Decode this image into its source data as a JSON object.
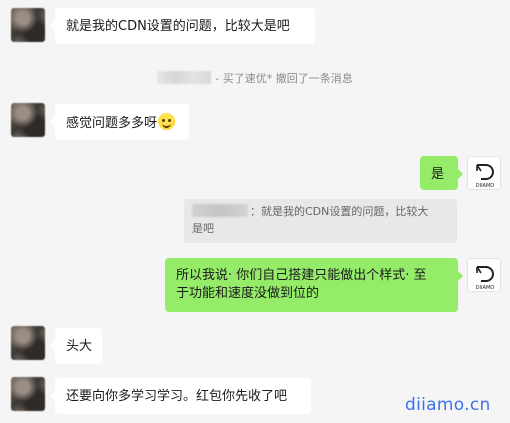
{
  "messages": [
    {
      "side": "left",
      "text": "就是我的CDN设置的问题，比较大是吧"
    },
    {
      "side": "left",
      "text": "感觉问题多多呀"
    },
    {
      "side": "right",
      "text": "是"
    },
    {
      "side": "right",
      "lines": [
        "所以我说· 你们自己搭建只能做出个样式· 至",
        "于功能和速度没做到位的"
      ]
    },
    {
      "side": "left",
      "text": "头大"
    },
    {
      "side": "left",
      "text": "还要向你多学习学习。红包你先收了吧"
    }
  ],
  "system_notice": "- 买了速优* 撤回了一条消息",
  "quote": {
    "line1": "：就是我的CDN设置的问题，比较大",
    "line2": "是吧"
  },
  "self_avatar_text": "DIIAMO",
  "watermark": "diiamo.cn",
  "colors": {
    "background": "#f5f5f5",
    "bubble_self": "#95ec69",
    "bubble_other": "#ffffff",
    "watermark": "#3d6ff0"
  }
}
